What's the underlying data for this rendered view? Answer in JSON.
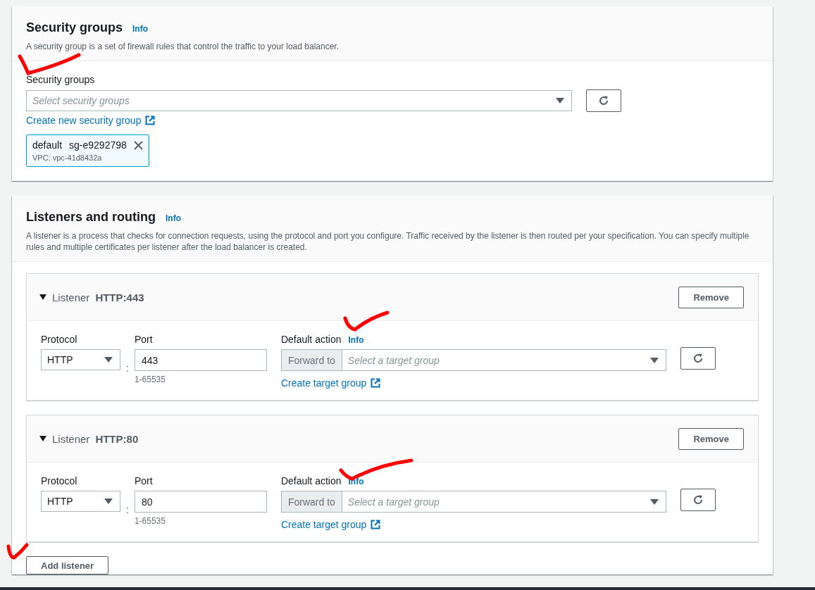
{
  "security_groups": {
    "title": "Security groups",
    "info": "Info",
    "description": "A security group is a set of firewall rules that control the traffic to your load balancer.",
    "field_label": "Security groups",
    "placeholder": "Select security groups",
    "create_link": "Create new security group",
    "tokens": [
      {
        "name": "default",
        "id": "sg-e9292798",
        "vpc": "VPC: vpc-41d8432a"
      }
    ]
  },
  "listeners_and_routing": {
    "title": "Listeners and routing",
    "info": "Info",
    "description": "A listener is a process that checks for connection requests, using the protocol and port you configure. Traffic received by the listener is then routed per your specification. You can specify multiple rules and multiple certificates per listener after the load balancer is created.",
    "listeners": [
      {
        "label": "Listener",
        "name": "HTTP:443",
        "expanded": true,
        "remove": "Remove",
        "protocol_label": "Protocol",
        "protocol": "HTTP",
        "separator": ":",
        "port_label": "Port",
        "port": "443",
        "port_hint": "1-65535",
        "action_label": "Default action",
        "action_info": "Info",
        "action_type": "Forward to",
        "target_placeholder": "Select a target group",
        "create_link": "Create target group"
      },
      {
        "label": "Listener",
        "name": "HTTP:80",
        "expanded": true,
        "remove": "Remove",
        "protocol_label": "Protocol",
        "protocol": "HTTP",
        "separator": ":",
        "port_label": "Port",
        "port": "80",
        "port_hint": "1-65535",
        "action_label": "Default action",
        "action_info": "Info",
        "action_type": "Forward to",
        "target_placeholder": "Select a target group",
        "create_link": "Create target group"
      }
    ],
    "add_button": "Add listener"
  }
}
